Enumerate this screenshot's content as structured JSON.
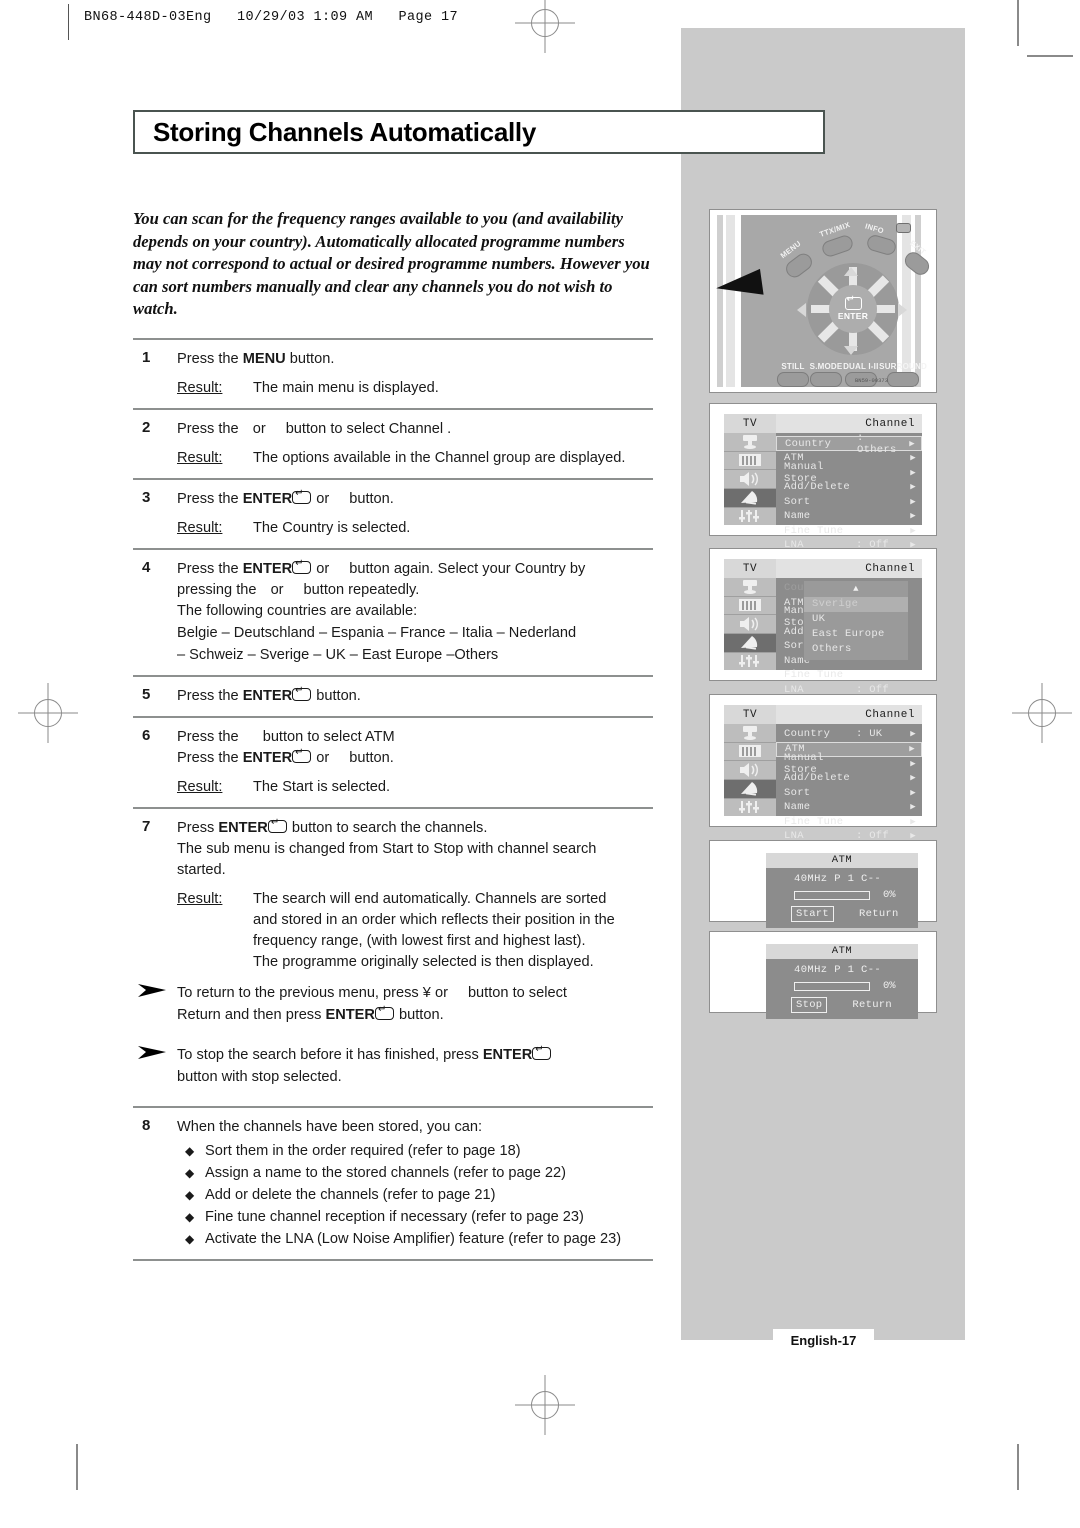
{
  "page_header": "BN68-448D-03Eng   10/29/03 1:09 AM   Page 17",
  "title": "Storing Channels Automatically",
  "intro": "You can scan for the frequency ranges available to you (and availability depends on your country). Automatically allocated programme numbers may not correspond to actual or desired programme numbers. However you can sort numbers manually and clear any channels you do not wish to watch.",
  "result_label": "Result:",
  "steps": {
    "s1": {
      "num": "1",
      "pre": "Press the ",
      "bold": "MENU",
      "post": " button.",
      "result": "The main menu is displayed."
    },
    "s2": {
      "num": "2",
      "pre": "Press the ",
      "mid": "or",
      "post": "button to select Channel .",
      "result": "The options available in the Channel  group are displayed."
    },
    "s3": {
      "num": "3",
      "pre": "Press the ",
      "bold": "ENTER",
      "mid": "or",
      "post": "button.",
      "result": "The Country  is selected."
    },
    "s4": {
      "num": "4",
      "pre": "Press the ",
      "bold": "ENTER",
      "mid": "or",
      "post": "button again. Select your Country  by",
      "line2a": "pressing the ",
      "line2b": "or",
      "line2c": "button repeatedly.",
      "line3": "The following countries are available:",
      "countries_line1": "Belgie   – Deutschland   – Espania  – France  – Italia   – Nederland",
      "countries_line2": "– Schweiz  – Sverige   – UK – East Europe   –Others"
    },
    "s5": {
      "num": "5",
      "pre": "Press the ",
      "bold": "ENTER",
      "post": " button."
    },
    "s6": {
      "num": "6",
      "line1a": "Press the ",
      "line1b": "button to select ATM",
      "line2a": "Press the ",
      "bold": "ENTER",
      "line2b": "or",
      "line2c": "button.",
      "result": "The Start  is selected."
    },
    "s7": {
      "num": "7",
      "pre": "Press ",
      "bold": "ENTER",
      "post": " button to search the channels.",
      "line2": "The sub menu is changed from Start  to Stop  with channel search",
      "line3": "started.",
      "result_l1": "The search will end automatically. Channels are sorted",
      "result_l2": "and stored in an order which reflects their position in the",
      "result_l3": "frequency range, (with lowest first and highest last).",
      "result_l4": "The programme originally selected is then displayed."
    },
    "note1": {
      "l1a": "To return to the previous menu, press  ¥ or",
      "l1b": "button to select",
      "l2a": "Return   and then press ",
      "bold": "ENTER",
      "l2b": " button."
    },
    "note2": {
      "l1": "To stop the search before it has finished, press ",
      "bold": "ENTER",
      "l2": "button with stop selected."
    },
    "s8": {
      "num": "8",
      "line1": "When the channels have been stored, you can:",
      "bullets": [
        "Sort them in the order required (refer to page 18)",
        "Assign a name to the stored channels (refer to page 22)",
        "Add or delete the channels (refer to page 21)",
        "Fine tune channel reception if necessary (refer to page 23)",
        "Activate the LNA (Low Noise Amplifier) feature (refer to page 23)"
      ]
    }
  },
  "remote": {
    "menu_label": "MENU",
    "ttx_label": "TTX/MIX",
    "info_label": "INFO",
    "exit_label": "EXIT",
    "enter_label": "ENTER",
    "bottom_buttons": [
      "STILL",
      "S.MODE",
      "DUAL I-II",
      "SURROUND"
    ],
    "part_code": "BN59-00373"
  },
  "osd": {
    "tv_label": "TV",
    "header": "Channel",
    "rows_labels": [
      "Country",
      "ATM",
      "Manual Store",
      "Add/Delete",
      "Sort",
      "Name",
      "Fine Tune",
      "LNA"
    ],
    "arrow": "▶",
    "screen1": {
      "country_value": ": Others",
      "lna_value": ": Off",
      "highlight": "Country"
    },
    "screen2": {
      "country_value": ":",
      "lna_value": ": Off",
      "popup_up_arrow": "▲",
      "popup_items": [
        "Sverige",
        "UK",
        "East Europe",
        "Others"
      ],
      "popup_selected": "Sverige"
    },
    "screen3": {
      "country_value": ": UK",
      "lna_value": ": Off",
      "highlight": "ATM"
    }
  },
  "atm": {
    "title": "ATM",
    "freq": "40MHz  P 1 C--",
    "percent": "0%",
    "return_label": "Return",
    "start_label": "Start",
    "stop_label": "Stop"
  },
  "footer": "English-17"
}
